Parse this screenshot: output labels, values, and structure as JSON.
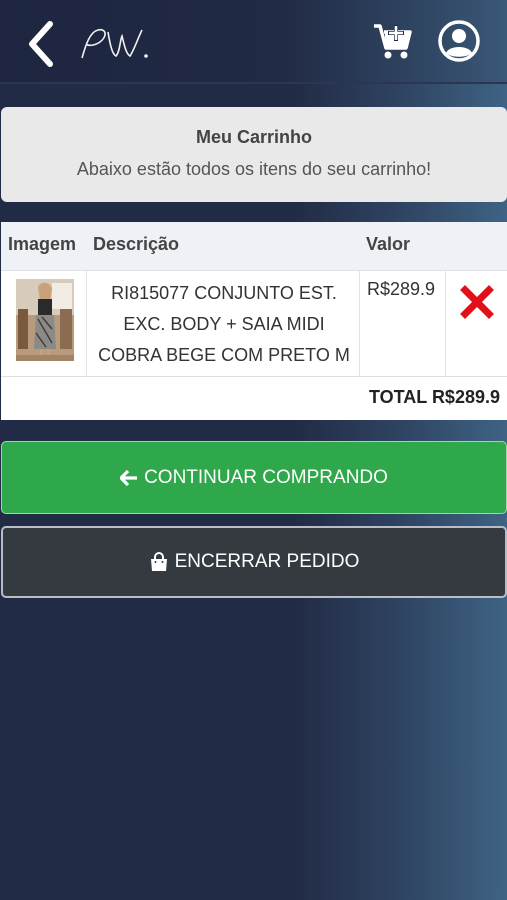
{
  "header": {
    "logo_text": "PW.",
    "back_icon": "chevron-left-icon",
    "cart_icon": "cart-add-icon",
    "user_icon": "user-circle-icon"
  },
  "cart_header": {
    "title": "Meu Carrinho",
    "subtitle": "Abaixo estão todos os itens do seu carrinho!"
  },
  "table": {
    "columns": [
      "Imagem",
      "Descrição",
      "Valor"
    ],
    "items": [
      {
        "description_lines": [
          "RI815077 CONJUNTO EST.",
          "EXC. BODY + SAIA MIDI",
          "COBRA BEGE COM PRETO M"
        ],
        "price": "R$289.9",
        "remove_icon": "red-x-icon"
      }
    ],
    "total": "TOTAL R$289.9"
  },
  "actions": {
    "continue_label": "CONTINUAR COMPRANDO",
    "finish_label": "ENCERRAR PEDIDO"
  },
  "colors": {
    "accent_green": "#2fa84b",
    "dark_button": "#343a40",
    "remove_red": "#e3101a"
  }
}
